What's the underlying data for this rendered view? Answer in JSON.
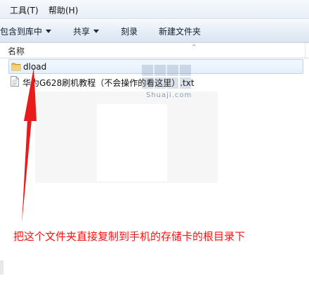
{
  "menubar": {
    "items": [
      "工具(T)",
      "帮助(H)"
    ]
  },
  "toolbar": {
    "include_library": "包含到库中",
    "share": "共享",
    "burn": "刻录",
    "new_folder": "新建文件夹"
  },
  "columns": {
    "name": "名称"
  },
  "files": [
    {
      "name": "dload",
      "icon": "folder-icon"
    },
    {
      "name": "华为G628刷机教程（不会操作的看这里）.txt",
      "icon": "text-file-icon"
    }
  ],
  "watermark": "Shuaji.com",
  "annotation": "把这个文件夹直接复制到手机的存储卡的根目录下",
  "colors": {
    "annotation": "#ff1010",
    "selection": "#e4effc",
    "folder": "#e9b543"
  }
}
